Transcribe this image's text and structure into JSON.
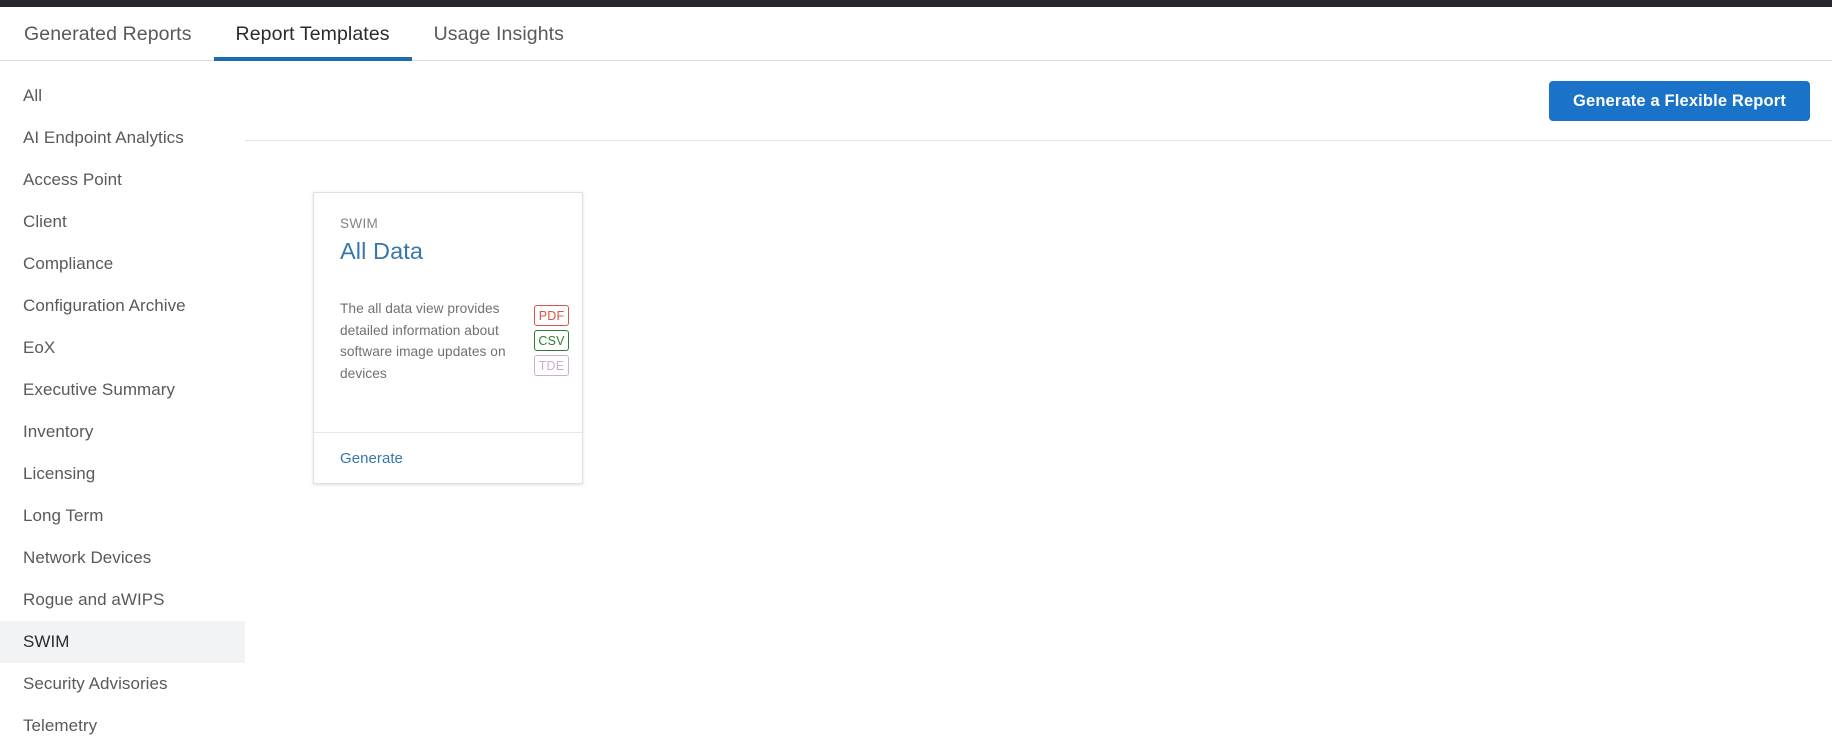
{
  "tabs": [
    {
      "label": "Generated Reports",
      "active": false
    },
    {
      "label": "Report Templates",
      "active": true
    },
    {
      "label": "Usage Insights",
      "active": false
    }
  ],
  "sidebar": {
    "items": [
      {
        "label": "All",
        "selected": false
      },
      {
        "label": "AI Endpoint Analytics",
        "selected": false
      },
      {
        "label": "Access Point",
        "selected": false
      },
      {
        "label": "Client",
        "selected": false
      },
      {
        "label": "Compliance",
        "selected": false
      },
      {
        "label": "Configuration Archive",
        "selected": false
      },
      {
        "label": "EoX",
        "selected": false
      },
      {
        "label": "Executive Summary",
        "selected": false
      },
      {
        "label": "Inventory",
        "selected": false
      },
      {
        "label": "Licensing",
        "selected": false
      },
      {
        "label": "Long Term",
        "selected": false
      },
      {
        "label": "Network Devices",
        "selected": false
      },
      {
        "label": "Rogue and aWIPS",
        "selected": false
      },
      {
        "label": "SWIM",
        "selected": true
      },
      {
        "label": "Security Advisories",
        "selected": false
      },
      {
        "label": "Telemetry",
        "selected": false
      }
    ]
  },
  "toolbar": {
    "flexible_report_label": "Generate a Flexible Report"
  },
  "cards": [
    {
      "eyebrow": "SWIM",
      "title": "All Data",
      "description": "The all data view provides detailed information about software image updates on devices",
      "formats": [
        {
          "label": "PDF",
          "state": "enabled",
          "color": "#d8534e"
        },
        {
          "label": "CSV",
          "state": "enabled",
          "color": "#2e7d32"
        },
        {
          "label": "TDE",
          "state": "disabled",
          "color": "#cbaed0"
        }
      ],
      "action_label": "Generate"
    }
  ],
  "colors": {
    "accent_blue": "#1a73c8",
    "link_blue": "#3777ab",
    "tab_underline": "#1f6bb0",
    "selected_row_bg": "#f2f3f5",
    "top_strip": "#26282b"
  }
}
